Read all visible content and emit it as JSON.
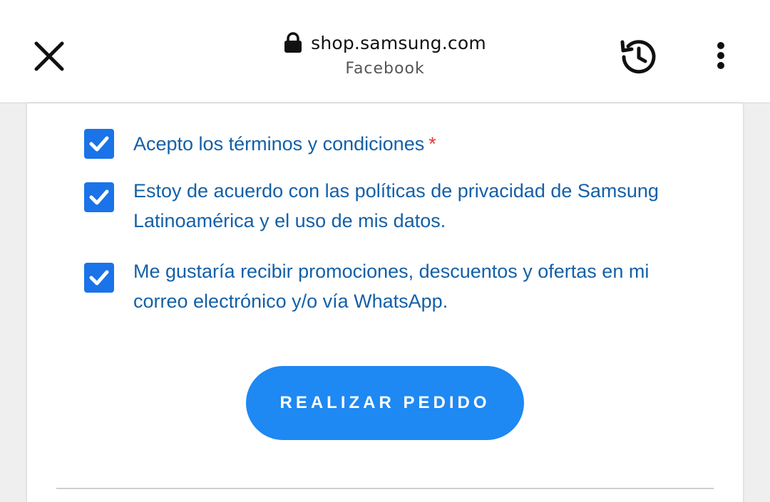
{
  "browser": {
    "url": "shop.samsung.com",
    "subtitle": "Facebook",
    "icons": {
      "close": "close-icon",
      "lock": "lock-icon",
      "history": "history-icon",
      "menu": "more-vertical-icon"
    }
  },
  "form": {
    "options": [
      {
        "label": "Acepto los términos y condiciones",
        "required_mark": "*",
        "checked": true
      },
      {
        "label": "Estoy de acuerdo con las políticas de privacidad de Samsung Latinoamérica y el uso de mis datos.",
        "checked": true
      },
      {
        "label": "Me gustaría recibir promociones, descuentos y ofertas en mi correo electrónico y/o vía WhatsApp.",
        "checked": true
      }
    ],
    "submit_label": "REALIZAR PEDIDO"
  },
  "colors": {
    "accent": "#1e88f3",
    "checkbox": "#1a73e8",
    "label_text": "#1460a8",
    "required": "#e53935"
  }
}
